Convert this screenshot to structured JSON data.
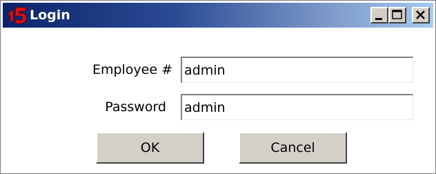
{
  "window": {
    "title": "Login",
    "icon": "app-logo-icon",
    "controls": {
      "minimize": "minimize-icon",
      "maximize": "maximize-icon",
      "close": "close-icon"
    }
  },
  "form": {
    "employee_label": "Employee #",
    "employee_value": "admin",
    "password_label": "Password",
    "password_value": "admin"
  },
  "buttons": {
    "ok_label": "OK",
    "cancel_label": "Cancel"
  },
  "colors": {
    "titlebar_start": "#0a246a",
    "titlebar_end": "#a6caf0",
    "button_face": "#d4d0c8",
    "logo_red": "#e01010"
  }
}
